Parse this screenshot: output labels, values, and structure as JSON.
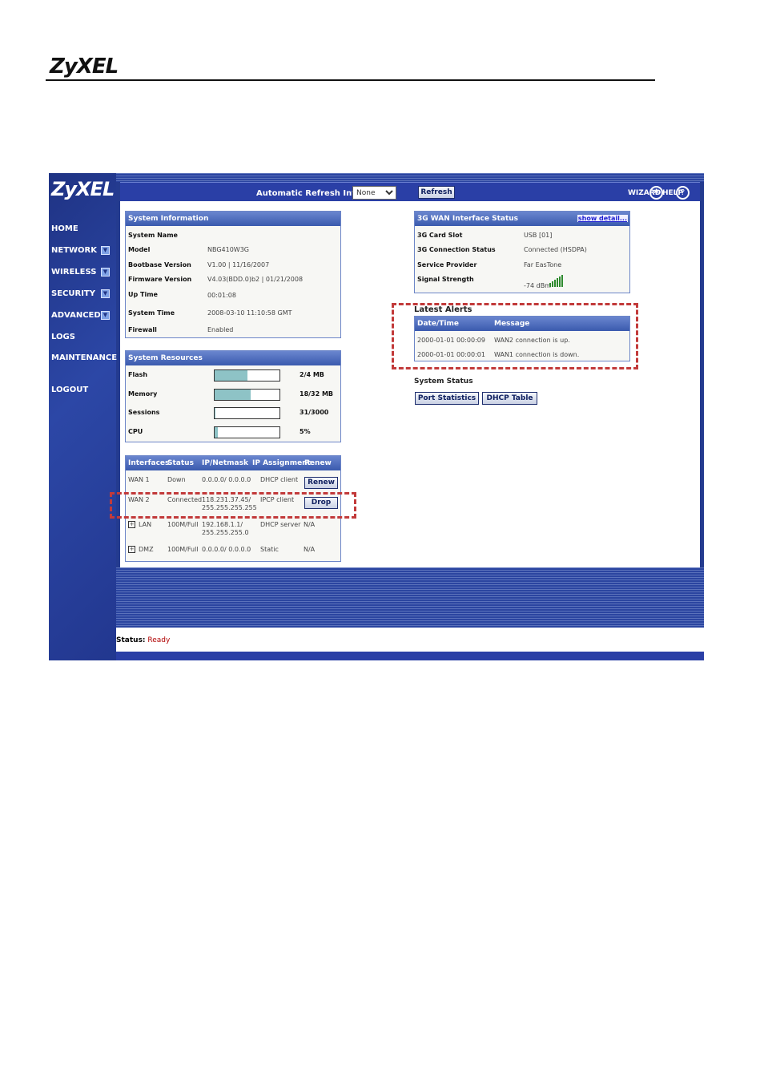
{
  "doc": {
    "logo": "ZyXEL"
  },
  "sidebar": {
    "logo": "ZyXEL",
    "items": [
      {
        "label": "HOME"
      },
      {
        "label": "NETWORK"
      },
      {
        "label": "WIRELESS"
      },
      {
        "label": "SECURITY"
      },
      {
        "label": "ADVANCED"
      },
      {
        "label": "LOGS"
      },
      {
        "label": "MAINTENANCE"
      },
      {
        "label": "LOGOUT"
      }
    ]
  },
  "topbar": {
    "refresh_label": "Automatic Refresh Interval",
    "refresh_value": "None",
    "refresh_button": "Refresh",
    "wizard": "WIZARD",
    "help": "HELP"
  },
  "system_info": {
    "title": "System Information",
    "rows": [
      {
        "label": "System Name",
        "value": ""
      },
      {
        "label": "Model",
        "value": "NBG410W3G"
      },
      {
        "label": "Bootbase Version",
        "value": "V1.00 | 11/16/2007"
      },
      {
        "label": "Firmware Version",
        "value": "V4.03(BDD.0)b2 | 01/21/2008"
      },
      {
        "label": "Up Time",
        "value": "00:01:08"
      },
      {
        "label": "System Time",
        "value": "2008-03-10 11:10:58 GMT"
      },
      {
        "label": "Firewall",
        "value": "Enabled"
      }
    ]
  },
  "resources": {
    "title": "System Resources",
    "rows": [
      {
        "label": "Flash",
        "value": "2/4 MB",
        "fraction": 0.5
      },
      {
        "label": "Memory",
        "value": "18/32 MB",
        "fraction": 0.56
      },
      {
        "label": "Sessions",
        "value": "31/3000",
        "fraction": 0.01
      },
      {
        "label": "CPU",
        "value": "5%",
        "fraction": 0.05
      }
    ]
  },
  "interfaces": {
    "headers": [
      "Interfaces",
      "Status",
      "IP/Netmask",
      "IP Assignment",
      "Renew"
    ],
    "rows": [
      {
        "name": "WAN 1",
        "status": "Down",
        "ip": "0.0.0.0/ 0.0.0.0",
        "ip2": "",
        "assign": "DHCP client",
        "renew": "Renew"
      },
      {
        "name": "WAN 2",
        "status": "Connected",
        "ip": "118.231.37.45/",
        "ip2": "255.255.255.255",
        "assign": "IPCP client",
        "renew": "Drop"
      },
      {
        "name": "LAN",
        "status": "100M/Full",
        "ip": "192.168.1.1/",
        "ip2": "255.255.255.0",
        "assign": "DHCP server",
        "renew": "N/A"
      },
      {
        "name": "DMZ",
        "status": "100M/Full",
        "ip": "0.0.0.0/ 0.0.0.0",
        "ip2": "",
        "assign": "Static",
        "renew": "N/A"
      }
    ]
  },
  "wan3g": {
    "title": "3G WAN Interface Status",
    "link": "show detail...",
    "rows": [
      {
        "label": "3G Card Slot",
        "value": "USB [01]"
      },
      {
        "label": "3G Connection Status",
        "value": "Connected (HSDPA)"
      },
      {
        "label": "Service Provider",
        "value": "Far EasTone"
      },
      {
        "label": "Signal Strength",
        "value": "-74 dBm"
      }
    ],
    "signal_bars": 6
  },
  "alerts": {
    "title": "Latest Alerts",
    "headers": [
      "Date/Time",
      "Message"
    ],
    "rows": [
      {
        "time": "2000-01-01 00:00:09",
        "message": "WAN2 connection is up."
      },
      {
        "time": "2000-01-01 00:00:01",
        "message": "WAN1 connection is down."
      }
    ]
  },
  "system_status": {
    "title": "System Status",
    "buttons": [
      "Port Statistics",
      "DHCP Table"
    ]
  },
  "statusbar": {
    "label": "Status:",
    "value": "Ready"
  }
}
